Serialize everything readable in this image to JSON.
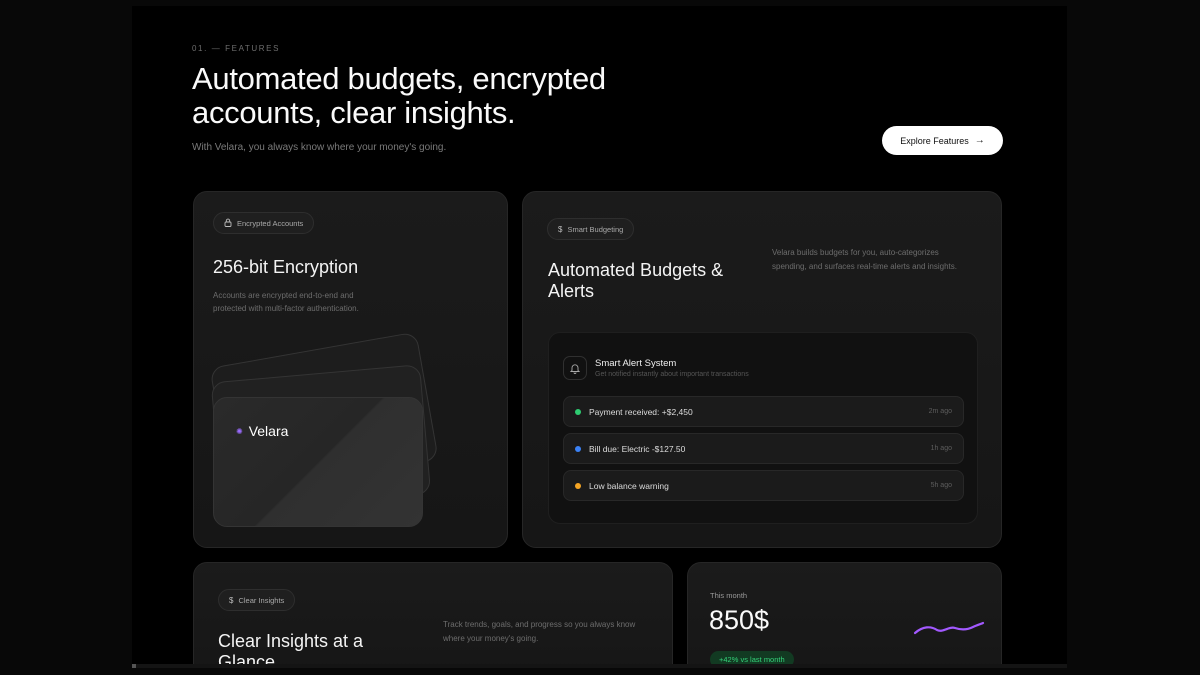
{
  "section": {
    "eyebrow": "01. — FEATURES",
    "headline": "Automated budgets, encrypted accounts, clear insights.",
    "subline": "With Velara, you always know where your money's going.",
    "cta_label": "Explore Features",
    "cta_icon": "arrow-right-icon"
  },
  "cards": {
    "encryption": {
      "pill": "Encrypted Accounts",
      "pill_icon": "lock-icon",
      "title": "256-bit Encryption",
      "desc": "Accounts are encrypted end-to-end and protected with multi-factor authentication.",
      "card_brand": "Velara",
      "brand_color": "#9b6cff"
    },
    "budgeting": {
      "pill": "Smart Budgeting",
      "pill_icon": "dollar-icon",
      "title": "Automated Budgets & Alerts",
      "desc": "Velara builds budgets for you, auto-categorizes spending, and surfaces real-time alerts and insights.",
      "panel": {
        "title": "Smart Alert System",
        "subtitle": "Get notified instantly about important transactions",
        "icon": "bell-icon",
        "alerts": [
          {
            "text": "Payment received: +$2,450",
            "time": "2m ago",
            "color": "#2ecc71"
          },
          {
            "text": "Bill due: Electric -$127.50",
            "time": "1h ago",
            "color": "#3b82f6"
          },
          {
            "text": "Low balance warning",
            "time": "5h ago",
            "color": "#f5a524"
          }
        ]
      }
    },
    "insights": {
      "pill": "Clear Insights",
      "pill_icon": "dollar-icon",
      "title": "Clear Insights at a Glance",
      "desc": "Track trends, goals, and progress so you always know where your money's going."
    },
    "month": {
      "label": "This month",
      "value": "850$",
      "badge": "+42% vs last month",
      "badge_color": "#35d27a",
      "spark_color": "#a259ff"
    }
  }
}
